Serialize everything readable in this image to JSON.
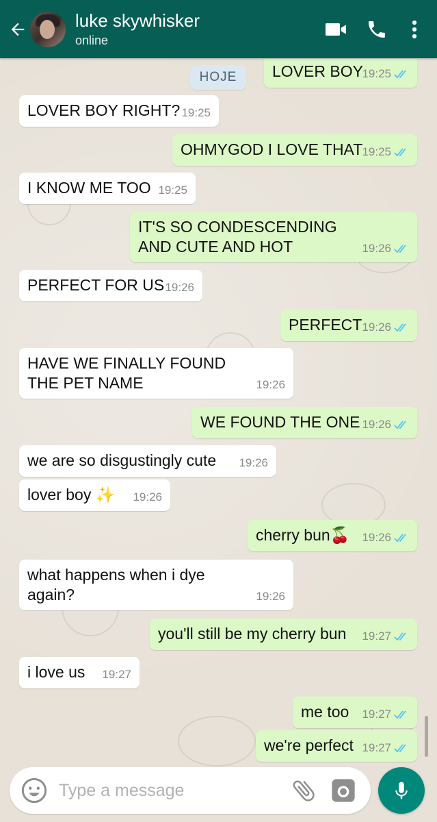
{
  "header": {
    "contact_name": "luke skywhisker",
    "status": "online",
    "icons": [
      "back-arrow-icon",
      "video-call-icon",
      "phone-call-icon",
      "more-options-icon"
    ]
  },
  "date_chip": "HOJE",
  "messages": [
    {
      "dir": "out",
      "text": "LOVER BOY",
      "time": "19:25",
      "read": true
    },
    {
      "dir": "in",
      "text": "LOVER BOY RIGHT?",
      "time": "19:25"
    },
    {
      "dir": "out",
      "text": "OHMYGOD I LOVE THAT",
      "time": "19:25",
      "read": true
    },
    {
      "dir": "in",
      "text": "I KNOW ME TOO",
      "time": "19:25"
    },
    {
      "dir": "out",
      "text": "IT'S SO CONDESCENDING\nAND CUTE AND HOT",
      "time": "19:26",
      "read": true
    },
    {
      "dir": "in",
      "text": "PERFECT FOR US",
      "time": "19:26"
    },
    {
      "dir": "out",
      "text": "PERFECT",
      "time": "19:26",
      "read": true
    },
    {
      "dir": "in",
      "text": "HAVE WE FINALLY FOUND\nTHE PET NAME",
      "time": "19:26"
    },
    {
      "dir": "out",
      "text": "WE FOUND THE ONE",
      "time": "19:26",
      "read": true
    },
    {
      "dir": "in",
      "text": "we are so disgustingly cute",
      "time": "19:26"
    },
    {
      "dir": "in",
      "text": "lover boy ✨",
      "time": "19:26"
    },
    {
      "dir": "out",
      "text": "cherry bun🍒",
      "time": "19:26",
      "read": true
    },
    {
      "dir": "in",
      "text": "what happens when i dye\nagain?",
      "time": "19:26"
    },
    {
      "dir": "out",
      "text": "you'll still be my cherry bun",
      "time": "19:27",
      "read": true
    },
    {
      "dir": "in",
      "text": "i love us",
      "time": "19:27"
    },
    {
      "dir": "out",
      "text": "me too",
      "time": "19:27",
      "read": true
    },
    {
      "dir": "out",
      "text": "we're perfect",
      "time": "19:27",
      "read": true
    }
  ],
  "composer": {
    "placeholder": "Type a message",
    "icons": [
      "emoji-icon",
      "attach-icon",
      "camera-icon",
      "microphone-icon"
    ]
  },
  "colors": {
    "header": "#075e54",
    "outgoing_bubble": "#dcf8c6",
    "incoming_bubble": "#ffffff",
    "read_tick": "#4fc3f7",
    "mic_button": "#00897b"
  }
}
